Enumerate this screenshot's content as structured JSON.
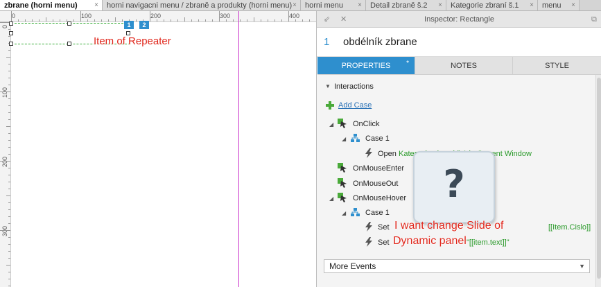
{
  "tabs": [
    {
      "label": "zbrane (horni menu)",
      "active": true
    },
    {
      "label": "horni navigacni menu / zbraně a produkty (horni menu)",
      "active": false
    },
    {
      "label": "horni menu",
      "active": false
    },
    {
      "label": "Detail zbraně š.2",
      "active": false
    },
    {
      "label": "Kategorie zbraní š.1",
      "active": false
    },
    {
      "label": "menu",
      "active": false
    }
  ],
  "tab_close_glyph": "×",
  "ruler": {
    "top_labels": [
      "0",
      "100",
      "200",
      "300",
      "400"
    ],
    "left_labels": [
      "0",
      "100",
      "200",
      "300"
    ]
  },
  "canvas": {
    "badges": [
      "1",
      "2"
    ],
    "repeater_note": "Item of Repeater"
  },
  "inspector": {
    "title": "Inspector: Rectangle",
    "number": "1",
    "name": "obdélník zbrane",
    "tabs": [
      "PROPERTIES",
      "NOTES",
      "STYLE"
    ],
    "properties_marker": "*",
    "interactions_label": "Interactions",
    "add_case_label": "Add Case",
    "events": {
      "onclick": "OnClick",
      "case1": "Case 1",
      "open_action": "Open",
      "open_target": "Kategorie zbraní š.1 in Current Window",
      "onmouseenter": "OnMouseEnter",
      "onmouseout": "OnMouseOut",
      "onmousehover": "OnMouseHover",
      "case1b": "Case 1",
      "set1_action": "Set",
      "set1_value": "[[Item.Cislo]]",
      "set2_action": "Set",
      "set2_value": "\"[[item.text]]\""
    },
    "more_events": "More Events"
  },
  "overlay": {
    "question_glyph": "?",
    "note_line1": "I want change Slide of",
    "note_line2": "Dynamic panel"
  },
  "colors": {
    "accent": "#2e8fce",
    "annotation_red": "#e0261b",
    "guide_magenta": "#cc33cc",
    "selection_green": "#33aa33"
  }
}
